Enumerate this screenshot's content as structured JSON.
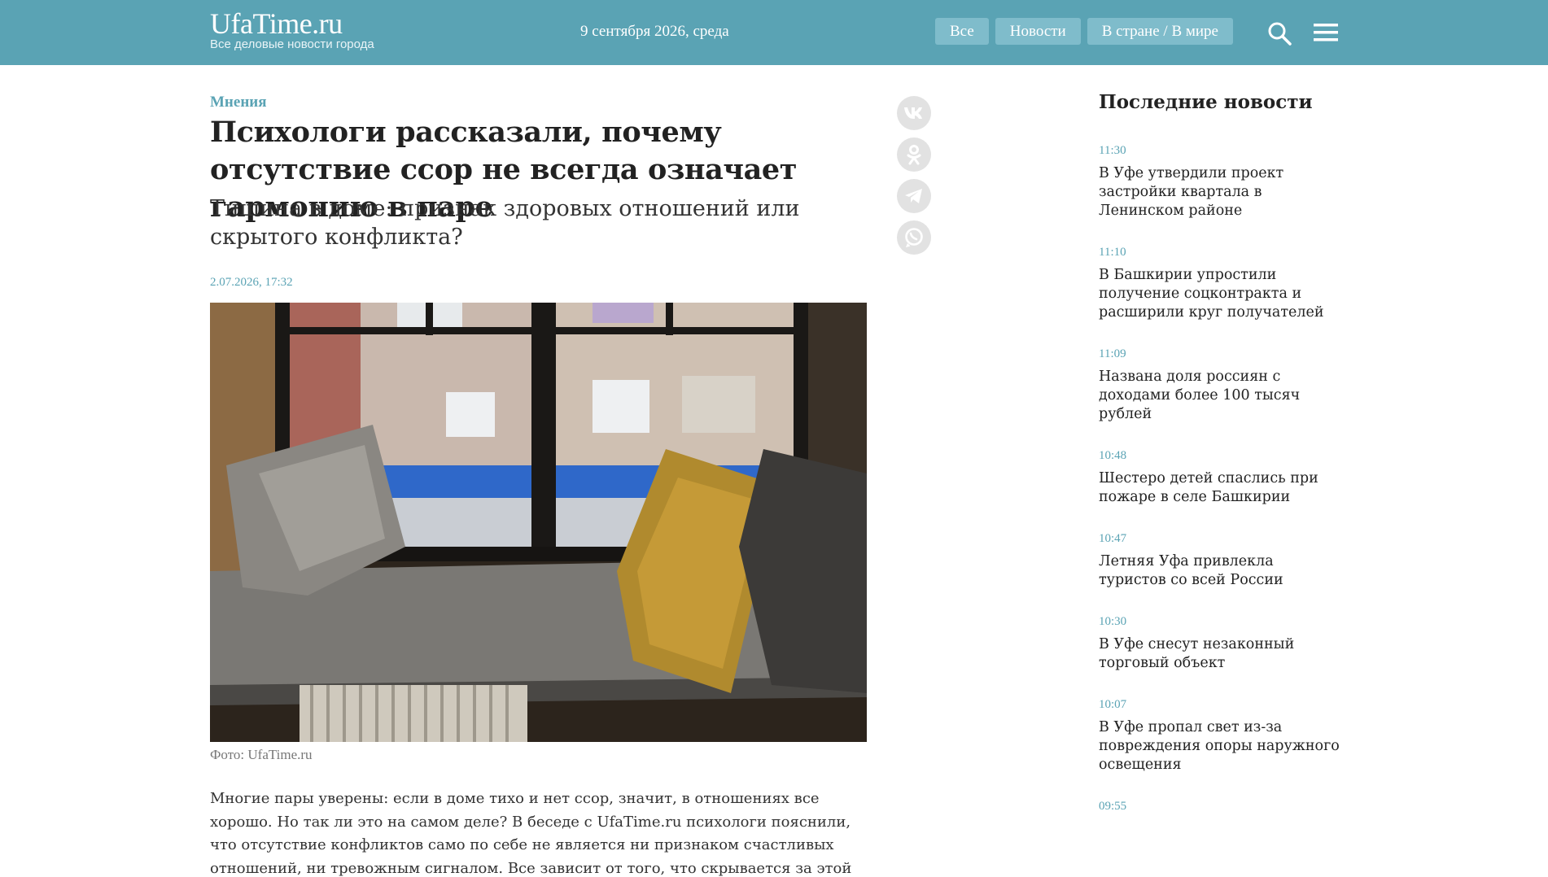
{
  "header": {
    "logo_title": "UfaTime.ru",
    "logo_subtitle": "Все деловые новости города",
    "date": "9 сентября 2026, среда",
    "nav": [
      "Все",
      "Новости",
      "В стране / В мире"
    ]
  },
  "article": {
    "category": "Мнения",
    "title": "Психологи рассказали, почему отсутствие ссор не всегда означает гармонию в паре",
    "subtitle": "Тишина в доме: признак здоровых отношений или скрытого конфликта?",
    "published": "2.07.2026, 17:32",
    "photo_caption": "Фото: UfaTime.ru",
    "body": "Многие пары уверены: если в доме тихо и нет ссор, значит, в отношениях все хорошо. Но так ли это на самом деле? В беседе с UfaTime.ru психологи пояснили, что отсутствие конфликтов само по себе не является ни признаком счастливых отношений, ни тревожным сигналом. Все зависит от того, что скрывается за этой тишиной."
  },
  "share": [
    "vk-icon",
    "odnoklassniki-icon",
    "telegram-icon",
    "whatsapp-icon"
  ],
  "sidebar": {
    "title": "Последние новости",
    "items": [
      {
        "time": "11:30",
        "title": "В Уфе утвердили проект застройки квартала в Ленинском районе"
      },
      {
        "time": "11:10",
        "title": "В Башкирии упростили получение соцконтракта и расширили круг получателей"
      },
      {
        "time": "11:09",
        "title": "Названа доля россиян с доходами более 100 тысяч рублей"
      },
      {
        "time": "10:48",
        "title": "Шестеро детей спаслись при пожаре в селе Башкирии"
      },
      {
        "time": "10:47",
        "title": "Летняя Уфа привлекла туристов со всей России"
      },
      {
        "time": "10:30",
        "title": "В Уфе снесут незаконный торговый объект"
      },
      {
        "time": "10:07",
        "title": "В Уфе пропал свет из-за повреждения опоры наружного освещения"
      },
      {
        "time": "09:55",
        "title": ""
      }
    ]
  },
  "colors": {
    "header_bg": "#5aa3b4",
    "nav_button_bg": "#7fbccb",
    "accent": "#5aa3b4"
  }
}
